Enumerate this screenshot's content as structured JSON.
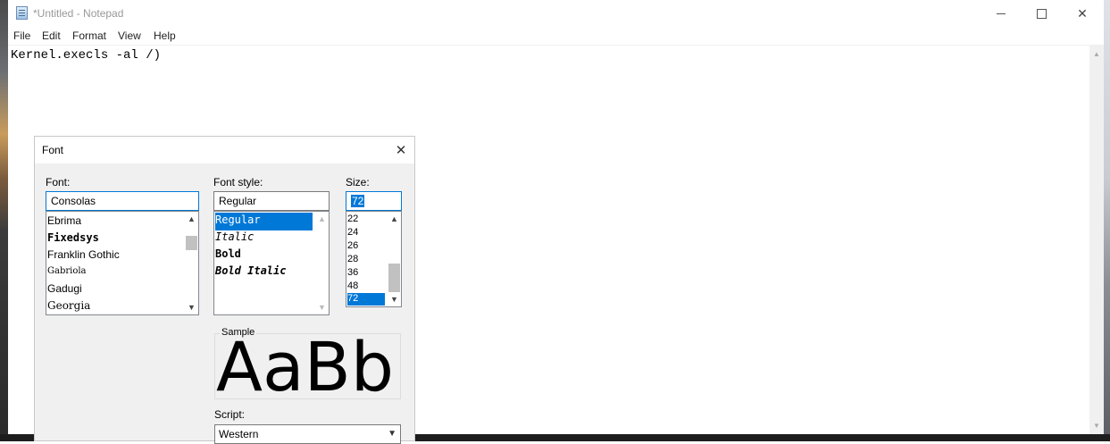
{
  "window": {
    "title": "*Untitled - Notepad",
    "controls": {
      "minimize": "—",
      "maximize": "☐",
      "close": "✕"
    }
  },
  "menu": [
    "File",
    "Edit",
    "Format",
    "View",
    "Help"
  ],
  "editor": {
    "text": "Kernel.execls -al /)"
  },
  "font_dialog": {
    "title": "Font",
    "font_label": "Font:",
    "font_value": "Consolas",
    "fonts": [
      "Ebrima",
      "Fixedsys",
      "Franklin Gothic",
      "Gabriola",
      "Gadugi",
      "Georgia"
    ],
    "style_label": "Font style:",
    "style_value": "Regular",
    "styles": [
      "Regular",
      "Italic",
      "Bold",
      "Bold Italic"
    ],
    "selected_style": "Regular",
    "size_label": "Size:",
    "size_value": "72",
    "sizes": [
      "22",
      "24",
      "26",
      "28",
      "36",
      "48",
      "72"
    ],
    "selected_size": "72",
    "sample_label": "Sample",
    "sample_text": "AaBb",
    "script_label": "Script:",
    "script_value": "Western"
  },
  "colors": {
    "accent": "#0078d7"
  }
}
